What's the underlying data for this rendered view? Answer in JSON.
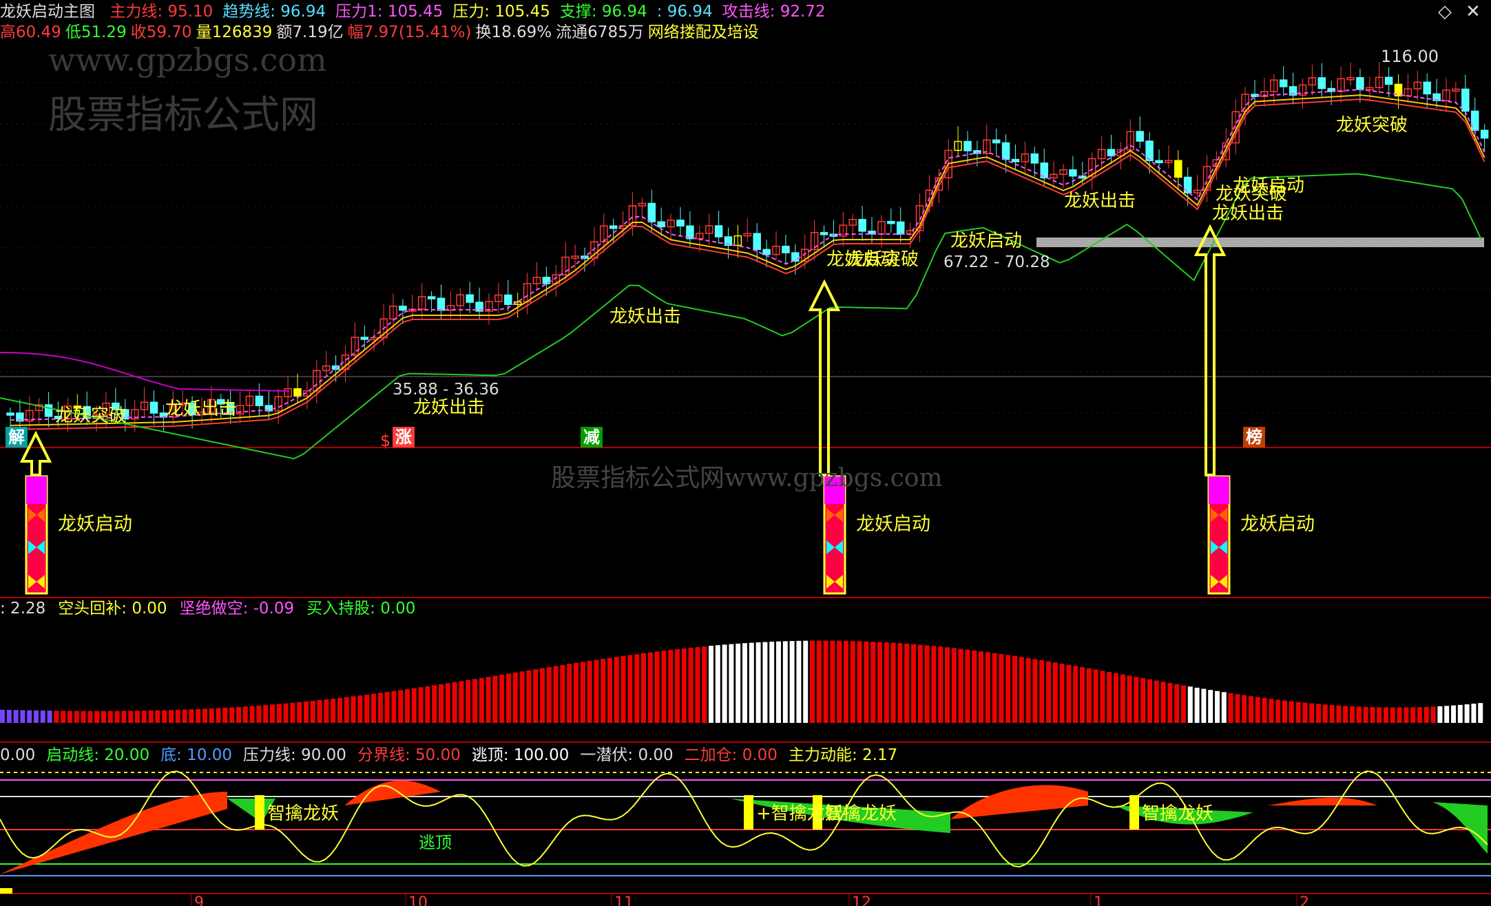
{
  "app": {
    "title": "龙妖启动主图"
  },
  "header_line1": [
    {
      "label": "主力线: 95.10",
      "color": "#ff3b3b"
    },
    {
      "label": "趋势线: 96.94",
      "color": "#55e0ff"
    },
    {
      "label": "压力1: 105.45",
      "color": "#ff55ff"
    },
    {
      "label": "压力: 105.45",
      "color": "#ffff33"
    },
    {
      "label": "支撑: 96.94",
      "color": "#33ff33"
    },
    {
      "label": ": 96.94",
      "color": "#55e0ff"
    },
    {
      "label": "攻击线: 92.72",
      "color": "#ff55ff"
    }
  ],
  "header_line2": [
    {
      "label": "高60.49",
      "color": "#ff3b3b"
    },
    {
      "label": "低51.29",
      "color": "#33ff33"
    },
    {
      "label": "收59.70",
      "color": "#ff3b3b"
    },
    {
      "label": "量126839",
      "color": "#ffff33"
    },
    {
      "label": "额7.19亿",
      "color": "#dddddd"
    },
    {
      "label": "幅7.97(15.41%)",
      "color": "#ff3b3b"
    },
    {
      "label": "换18.69%",
      "color": "#dddddd"
    },
    {
      "label": "流通6785万",
      "color": "#dddddd"
    },
    {
      "label": "网络搂配及培设",
      "color": "#ffff33"
    }
  ],
  "watermarks": {
    "url_top": "www.gpzbgs.com",
    "site_top": "股票指标公式网",
    "center": "股票指标公式网www.gpzbgs.com"
  },
  "icons": {
    "diamond": "diamond-icon",
    "close": "close-icon"
  },
  "main_chart": {
    "price_labels": {
      "high": "116.00",
      "range_a": "35.88 - 36.36",
      "range_b": "67.22 - 70.28"
    },
    "signal_text": {
      "strike": "龙妖出击",
      "breakout": "龙妖突破",
      "launch": "龙妖启动"
    },
    "events": [
      {
        "label": "解",
        "color": "#00a0a0"
      },
      {
        "label": "涨",
        "color": "#ff3b3b"
      },
      {
        "label": "减",
        "color": "#00a000"
      },
      {
        "label": "榜",
        "color": "#c04000"
      }
    ],
    "event_symbol": "$"
  },
  "panel2": {
    "label": "龙妖启动",
    "colors": {
      "border": "#ffff33",
      "top": "#ff00ff",
      "mid": "#ff0044",
      "butterfly_a": "#ff6a00",
      "butterfly_b": "#00ffff",
      "butterfly_c": "#ffee00"
    }
  },
  "panel3": {
    "legend": [
      {
        "label": ": 2.28",
        "color": "#dddddd"
      },
      {
        "label": "空头回补: 0.00",
        "color": "#ffff33"
      },
      {
        "label": "坚绝做空: -0.09",
        "color": "#ff55ff"
      },
      {
        "label": "买入持股: 0.00",
        "color": "#33ff33"
      }
    ]
  },
  "panel4": {
    "legend": [
      {
        "label": "0.00",
        "color": "#dddddd"
      },
      {
        "label": "启动线: 20.00",
        "color": "#33ff33"
      },
      {
        "label": "底: 10.00",
        "color": "#5599ff"
      },
      {
        "label": "压力线: 90.00",
        "color": "#dddddd"
      },
      {
        "label": "分界线: 50.00",
        "color": "#ff3b3b"
      },
      {
        "label": "逃顶: 100.00",
        "color": "#ffffff"
      },
      {
        "label": "一潜伏: 0.00",
        "color": "#dddddd"
      },
      {
        "label": "二加仓: 0.00",
        "color": "#ff3b3b"
      },
      {
        "label": "主力动能: 2.17",
        "color": "#ffff33"
      }
    ],
    "signal": "智擒龙妖",
    "escape": "逃顶"
  },
  "time_axis": [
    "9",
    "10",
    "11",
    "12",
    "1",
    "2"
  ]
}
